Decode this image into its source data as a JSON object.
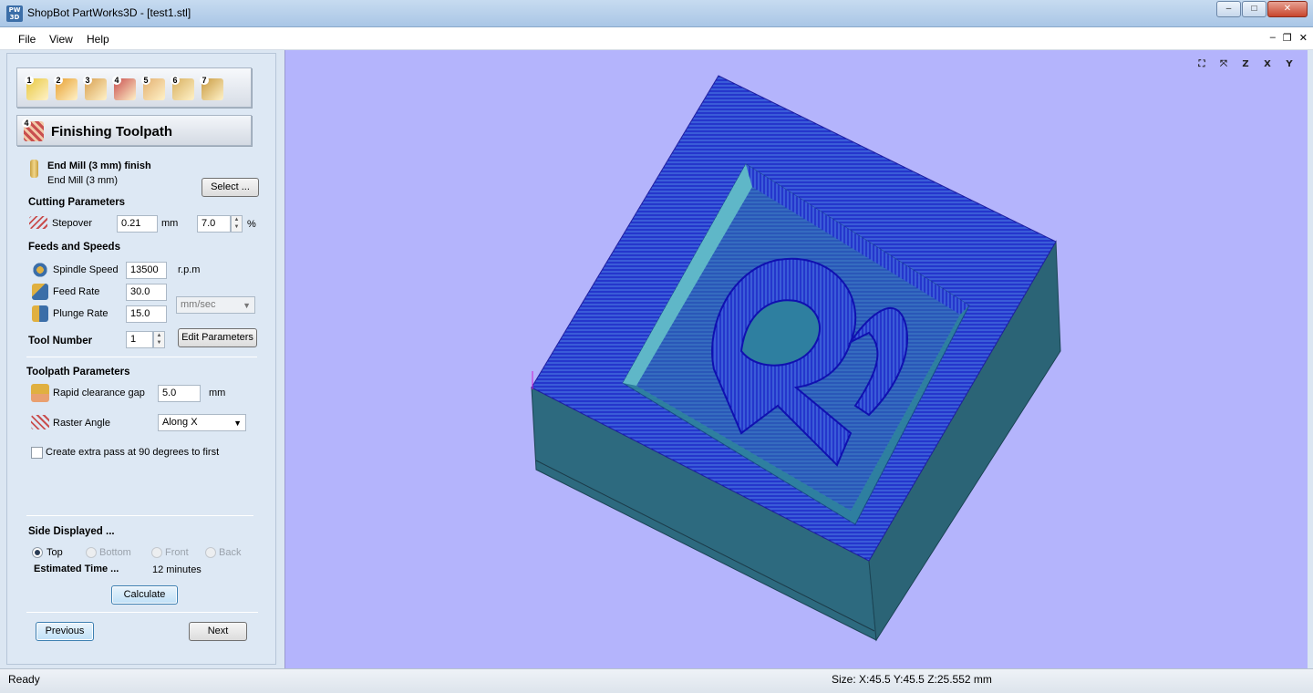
{
  "window": {
    "app_icon": "PW 3D",
    "title": "ShopBot PartWorks3D - [test1.stl]",
    "minimize": "–",
    "maximize": "□",
    "close": "✕"
  },
  "menu": {
    "items": [
      {
        "label": "File"
      },
      {
        "label": "View"
      },
      {
        "label": "Help"
      }
    ],
    "mdi_min": "–",
    "mdi_restore": "❐",
    "mdi_close": "✕"
  },
  "toolbar": {
    "steps": [
      "1",
      "2",
      "3",
      "4",
      "5",
      "6",
      "7"
    ],
    "step_colors": [
      "#e8c840",
      "#e8a030",
      "#d8a050",
      "#c94f4f",
      "#e3b070",
      "#d8b060",
      "#c99a40"
    ]
  },
  "panel": {
    "heading_num": "4",
    "heading": "Finishing Toolpath",
    "tool": {
      "name": "End Mill (3 mm) finish",
      "sub": "End Mill (3 mm)",
      "select_label": "Select ..."
    },
    "cutting": {
      "title": "Cutting Parameters",
      "stepover_label": "Stepover",
      "stepover_value": "0.21",
      "stepover_unit": "mm",
      "stepover_pct": "7.0",
      "pct_sign": "%"
    },
    "feeds": {
      "title": "Feeds and Speeds",
      "spindle_label": "Spindle Speed",
      "spindle_value": "13500",
      "spindle_unit": "r.p.m",
      "feed_label": "Feed Rate",
      "feed_value": "30.0",
      "plunge_label": "Plunge Rate",
      "plunge_value": "15.0",
      "rate_unit": "mm/sec",
      "tool_number_label": "Tool Number",
      "tool_number_value": "1",
      "edit_params_label": "Edit Parameters"
    },
    "toolpath": {
      "title": "Toolpath Parameters",
      "rapid_label": "Rapid clearance gap",
      "rapid_value": "5.0",
      "rapid_unit": "mm",
      "raster_label": "Raster Angle",
      "raster_value": "Along X",
      "extra_pass_label": "Create extra pass at 90 degrees to first"
    },
    "side": {
      "title": "Side Displayed ...",
      "options": [
        "Top",
        "Bottom",
        "Front",
        "Back"
      ],
      "selected": "Top"
    },
    "estimated": {
      "label": "Estimated Time ...",
      "value": "12 minutes"
    },
    "calculate_label": "Calculate",
    "previous_label": "Previous",
    "next_label": "Next"
  },
  "view_icons": [
    {
      "name": "fit-view-icon",
      "glyph": "⛶"
    },
    {
      "name": "iso-view-icon",
      "glyph": "⤧"
    },
    {
      "name": "z-view-icon",
      "glyph": "Z"
    },
    {
      "name": "x-view-icon",
      "glyph": "X"
    },
    {
      "name": "y-view-icon",
      "glyph": "Y"
    }
  ],
  "status": {
    "left": "Ready",
    "size": "Size: X:45.5 Y:45.5 Z:25.552 mm"
  },
  "colors": {
    "viewport_bg": "#b4b4fc",
    "block_side": "#2d6a7f",
    "toolpath": "#1a1ad0"
  }
}
